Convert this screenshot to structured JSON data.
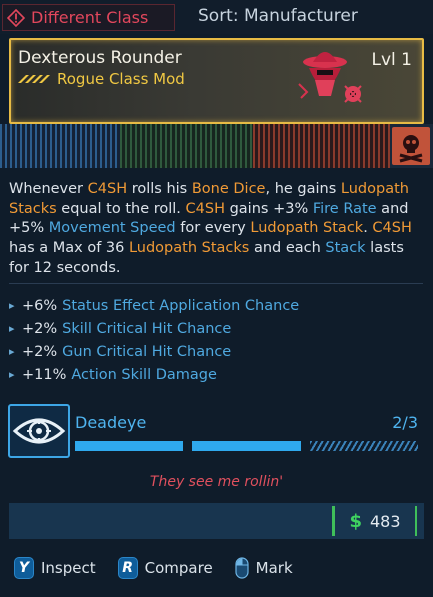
{
  "topbar": {
    "warning_label": "Different Class",
    "sort_label": "Sort: Manufacturer"
  },
  "item": {
    "name": "Dexterous Rounder",
    "level": "Lvl 1",
    "type": "Rogue Class Mod",
    "rarity_color": "#e7bb45"
  },
  "description": [
    {
      "t": "Whenever ",
      "c": ""
    },
    {
      "t": "C4SH",
      "c": "o"
    },
    {
      "t": " rolls his ",
      "c": ""
    },
    {
      "t": "Bone Dice",
      "c": "o"
    },
    {
      "t": ", he gains ",
      "c": ""
    },
    {
      "t": "Ludopath Stacks",
      "c": "o"
    },
    {
      "t": " equal to the roll. ",
      "c": ""
    },
    {
      "t": "C4SH",
      "c": "o"
    },
    {
      "t": " gains +3% ",
      "c": ""
    },
    {
      "t": "Fire Rate",
      "c": "b"
    },
    {
      "t": " and +5% ",
      "c": ""
    },
    {
      "t": "Movement Speed",
      "c": "b"
    },
    {
      "t": " for every ",
      "c": ""
    },
    {
      "t": "Ludopath Stack",
      "c": "o"
    },
    {
      "t": ". ",
      "c": ""
    },
    {
      "t": "C4SH",
      "c": "o"
    },
    {
      "t": " has a Max of 36 ",
      "c": ""
    },
    {
      "t": "Ludopath Stacks",
      "c": "o"
    },
    {
      "t": " and each ",
      "c": ""
    },
    {
      "t": "Stack",
      "c": "b"
    },
    {
      "t": " lasts for 12 seconds.",
      "c": ""
    }
  ],
  "stats": [
    {
      "value": "+6%",
      "name": "Status Effect Application Chance"
    },
    {
      "value": "+2%",
      "name": "Skill Critical Hit Chance"
    },
    {
      "value": "+2%",
      "name": "Gun Critical Hit Chance"
    },
    {
      "value": "+11%",
      "name": "Action Skill Damage"
    }
  ],
  "skill": {
    "name": "Deadeye",
    "points": "2/3",
    "points_current": 2,
    "points_max": 3,
    "icon": "eye-crosshair-icon"
  },
  "flavor_text": "They see me rollin'",
  "price": {
    "currency_symbol": "$",
    "value": "483"
  },
  "actions": [
    {
      "key": "Y",
      "label": "Inspect"
    },
    {
      "key": "R",
      "label": "Compare"
    },
    {
      "key": "mouse-icon",
      "label": "Mark"
    }
  ],
  "colors": {
    "orange_highlight": "#f09a36",
    "blue_highlight": "#4fa9e0",
    "warning": "#e2475c",
    "price_green": "#3fd460"
  }
}
